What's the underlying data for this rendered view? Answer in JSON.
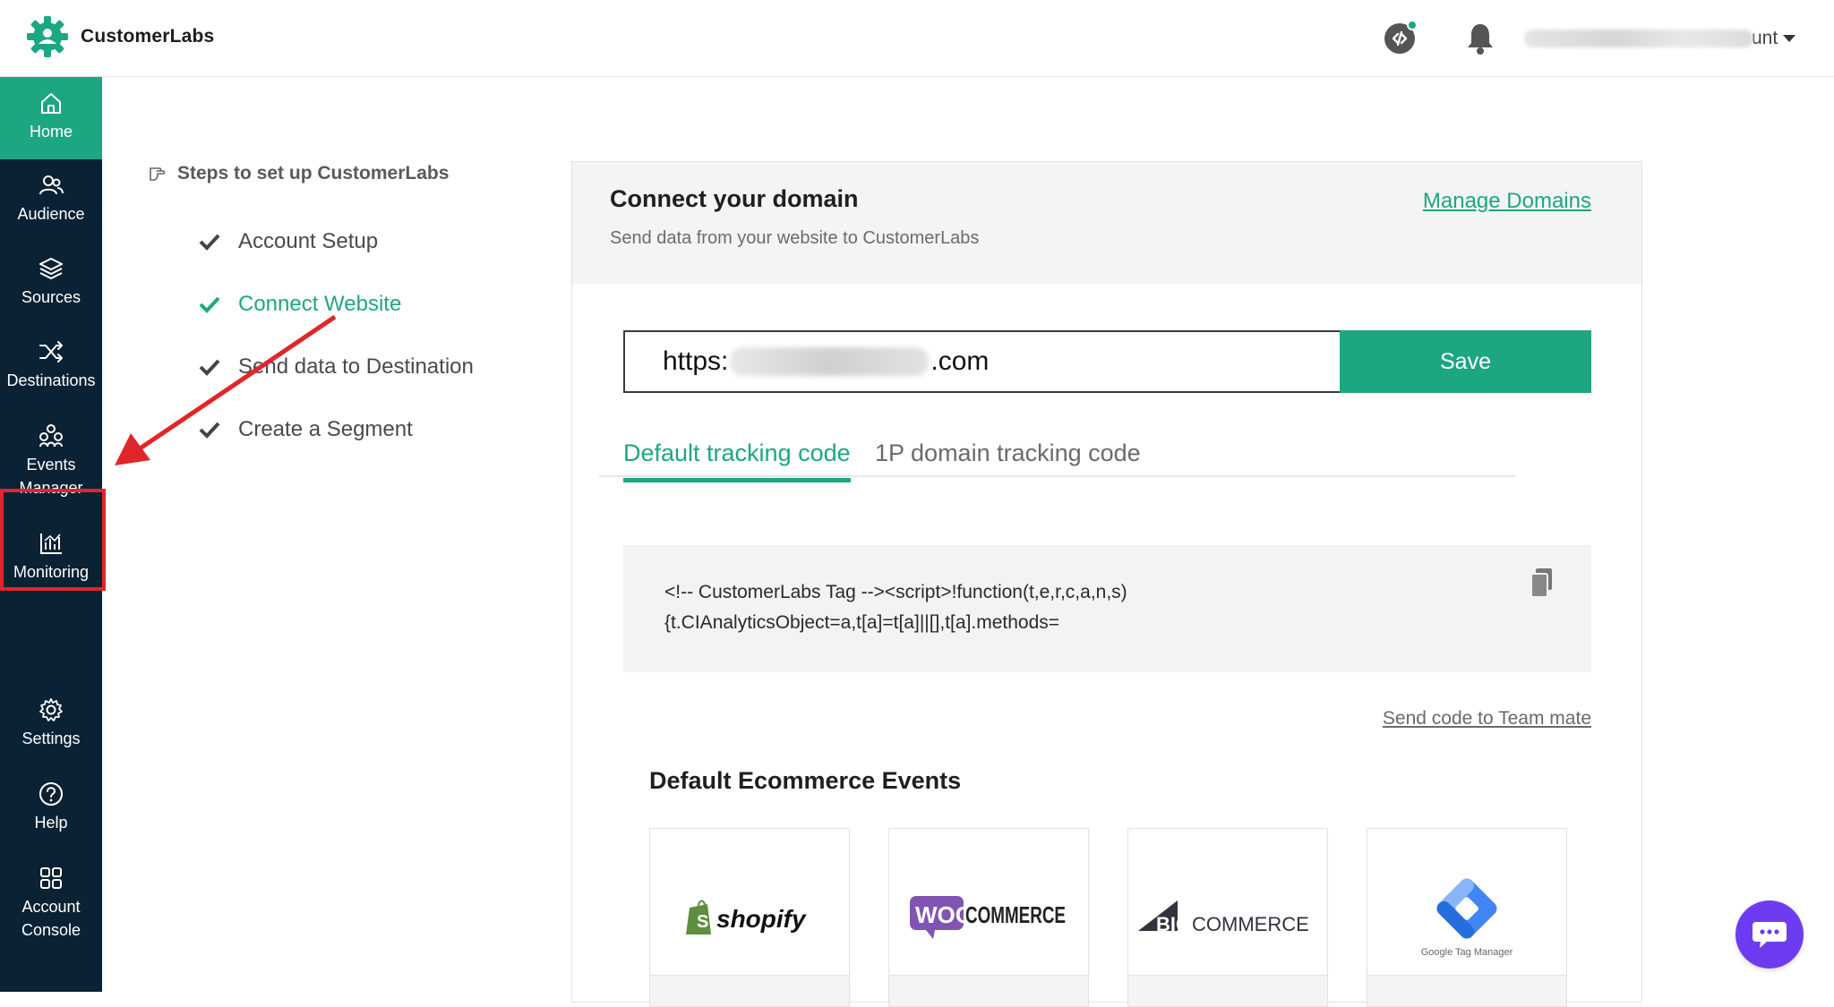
{
  "app": {
    "name": "CustomerLabs",
    "brand_color": "#1da682",
    "sidebar_color": "#0b2234"
  },
  "header": {
    "account_name_visible": "unt"
  },
  "sidebar": {
    "items": [
      {
        "label": "Home",
        "icon": "home-icon",
        "active": true
      },
      {
        "label": "Audience",
        "icon": "audience-icon"
      },
      {
        "label": "Sources",
        "icon": "layers-icon"
      },
      {
        "label": "Destinations",
        "icon": "shuffle-icon"
      },
      {
        "label": "Events\nManager",
        "label_line1": "Events",
        "label_line2": "Manager",
        "icon": "events-icon",
        "highlighted": true
      },
      {
        "label": "Monitoring",
        "icon": "chart-icon"
      },
      {
        "label": "Settings",
        "icon": "gear-icon"
      },
      {
        "label": "Help",
        "icon": "help-icon"
      },
      {
        "label_line1": "Account",
        "label_line2": "Console",
        "icon": "grid-icon"
      }
    ]
  },
  "steps": {
    "title": "Steps to set up CustomerLabs",
    "items": [
      {
        "label": "Account Setup"
      },
      {
        "label": "Connect Website",
        "current": true
      },
      {
        "label": "Send data to Destination"
      },
      {
        "label": "Create a Segment"
      }
    ]
  },
  "domain": {
    "title": "Connect your domain",
    "subtitle": "Send data from your website to CustomerLabs",
    "manage_link": "Manage Domains",
    "url_prefix": "https:",
    "url_suffix": ".com",
    "save_label": "Save",
    "tabs": [
      {
        "label": "Default tracking code",
        "active": true
      },
      {
        "label": "1P domain tracking code"
      }
    ],
    "code_line1": "<!-- CustomerLabs Tag --><script>!function(t,e,r,c,a,n,s)",
    "code_line2": "{t.CIAnalyticsObject=a,t[a]=t[a]||[],t[a].methods=",
    "send_link": "Send code to Team mate"
  },
  "events": {
    "title": "Default Ecommerce Events",
    "platforms": [
      {
        "logo": "shopify",
        "text": "shopify"
      },
      {
        "logo": "woocommerce",
        "text_left": "WOO",
        "text_right": "COMMERCE"
      },
      {
        "logo": "bigcommerce",
        "text_left": "BIG",
        "text_right": "COMMERCE"
      },
      {
        "logo": "google-tag-manager",
        "text": "Google Tag Manager"
      }
    ]
  }
}
